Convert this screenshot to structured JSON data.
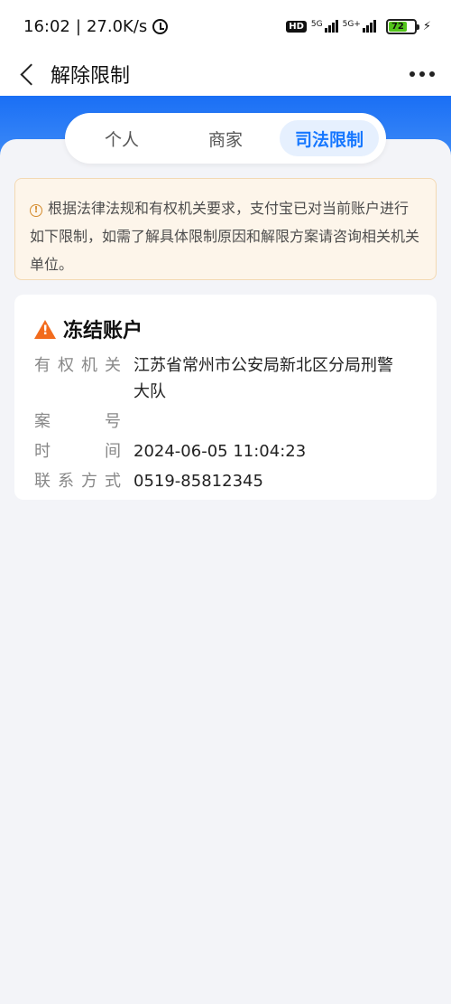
{
  "status_bar": {
    "time": "16:02",
    "net_speed": "27.0K/s",
    "hd_label": "HD",
    "sim1_label": "5G",
    "sim2_label": "5G+",
    "battery": "72",
    "battery_level": 0.72
  },
  "nav": {
    "title": "解除限制"
  },
  "tabs": [
    {
      "label": "个人",
      "active": false
    },
    {
      "label": "商家",
      "active": false
    },
    {
      "label": "司法限制",
      "active": true
    }
  ],
  "notice": {
    "text": "根据法律法规和有权机关要求，支付宝已对当前账户进行如下限制，如需了解具体限制原因和解限方案请咨询相关机关单位。"
  },
  "restriction": {
    "title": "冻结账户",
    "rows": [
      {
        "label": [
          "有",
          "权",
          "机",
          "关"
        ],
        "value": "江苏省常州市公安局新北区分局刑警大队"
      },
      {
        "label": [
          "案",
          "号"
        ],
        "value": ""
      },
      {
        "label": [
          "时",
          "间"
        ],
        "value": "2024-06-05 11:04:23"
      },
      {
        "label": [
          "联",
          "系",
          "方",
          "式"
        ],
        "value": "0519-85812345"
      }
    ]
  },
  "colors": {
    "accent": "#1677ff",
    "warning": "#f26b1d",
    "notice_bg": "#fdf5ea"
  }
}
